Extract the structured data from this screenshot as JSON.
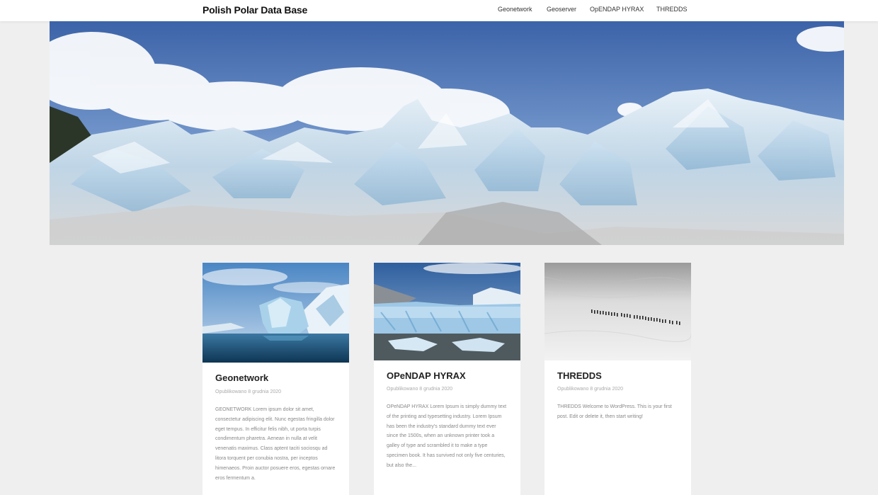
{
  "header": {
    "site_title": "Polish Polar Data Base",
    "nav": [
      "Geonetwork",
      "Geoserver",
      "OpENDAP HYRAX",
      "THREDDS"
    ]
  },
  "hero": {
    "image": "glacier-panorama"
  },
  "cards": [
    {
      "title": "Geonetwork",
      "date": "Opublikowano 8 grudnia 2020",
      "excerpt": "GEONETWORK Lorem ipsum dolor sit amet, consectetur adipiscing elit. Nunc egestas fringilla dolor eget tempus. In efficitur felis nibh, ut porta turpis condimentum pharetra. Aenean in nulla at velit venenatis maximus. Class aptent taciti sociosqu ad litora torquent per conubia nostra, per inceptos himenaeos. Proin auctor posuere eros, egestas ornare eros fermentum a.",
      "image": "iceberg-lagoon"
    },
    {
      "title": "OPeNDAP HYRAX",
      "date": "Opublikowano 8 grudnia 2020",
      "excerpt": "OPeNDAP HYRAX Lorem Ipsum is simply dummy text of the printing and typesetting industry. Lorem Ipsum has been the industry's standard dummy text ever since the 1500s, when an unknown printer took a galley of type and scrambled it to make a type specimen book. It has survived not only five centuries, but also the...",
      "image": "glacier-front"
    },
    {
      "title": "THREDDS",
      "date": "Opublikowano 8 grudnia 2020",
      "excerpt": "THREDDS Welcome to WordPress. This is your first post. Edit or delete it, then start writing!",
      "image": "snowfield-expedition"
    }
  ]
}
